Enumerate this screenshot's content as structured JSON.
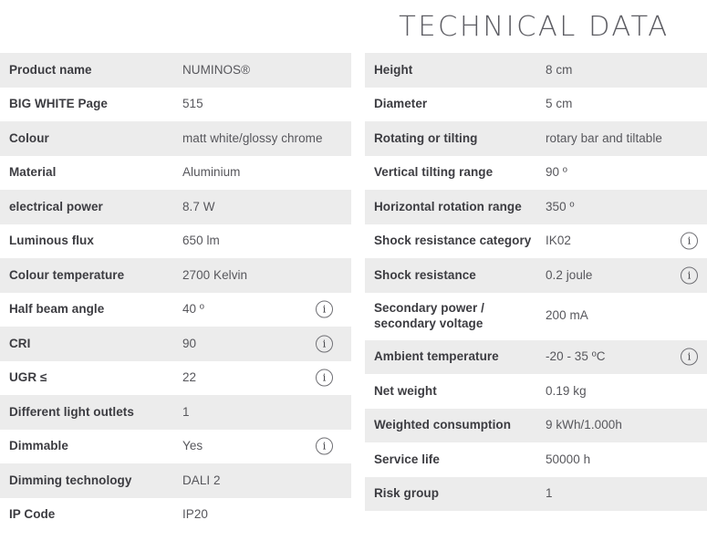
{
  "header": {
    "title": "TECHNICAL DATA"
  },
  "colors": {
    "row_shaded": "#ececec",
    "row_plain": "#ffffff",
    "label_text": "#3c3c41",
    "value_text": "#57575c",
    "title_text": "#5d5d63",
    "icon_border": "#6e6e73"
  },
  "icons": {
    "info": "i"
  },
  "left_column": {
    "rows": [
      {
        "label": "Product name",
        "value": "NUMINOS®",
        "shaded": true,
        "info": false
      },
      {
        "label": "BIG WHITE Page",
        "value": "515",
        "shaded": false,
        "info": false
      },
      {
        "label": "Colour",
        "value": "matt white/glossy chrome",
        "shaded": true,
        "info": false
      },
      {
        "label": "Material",
        "value": "Aluminium",
        "shaded": false,
        "info": false
      },
      {
        "label": "electrical power",
        "value": "8.7 W",
        "shaded": true,
        "info": false
      },
      {
        "label": "Luminous flux",
        "value": "650 lm",
        "shaded": false,
        "info": false
      },
      {
        "label": "Colour temperature",
        "value": "2700 Kelvin",
        "shaded": true,
        "info": false
      },
      {
        "label": "Half beam angle",
        "value": "40 º",
        "shaded": false,
        "info": true
      },
      {
        "label": "CRI",
        "value": "90",
        "shaded": true,
        "info": true
      },
      {
        "label": "UGR ≤",
        "value": "22",
        "shaded": false,
        "info": true
      },
      {
        "label": "Different light outlets",
        "value": "1",
        "shaded": true,
        "info": false
      },
      {
        "label": "Dimmable",
        "value": "Yes",
        "shaded": false,
        "info": true
      },
      {
        "label": "Dimming technology",
        "value": "DALI 2",
        "shaded": true,
        "info": false
      },
      {
        "label": "IP Code",
        "value": "IP20",
        "shaded": false,
        "info": false
      }
    ]
  },
  "right_column": {
    "rows": [
      {
        "label": "Height",
        "value": "8 cm",
        "shaded": true,
        "info": false,
        "tall": false
      },
      {
        "label": "Diameter",
        "value": "5 cm",
        "shaded": false,
        "info": false,
        "tall": false
      },
      {
        "label": "Rotating or tilting",
        "value": "rotary bar and tiltable",
        "shaded": true,
        "info": false,
        "tall": false
      },
      {
        "label": "Vertical tilting range",
        "value": "90 º",
        "shaded": false,
        "info": false,
        "tall": false
      },
      {
        "label": "Horizontal rotation range",
        "value": "350 º",
        "shaded": true,
        "info": false,
        "tall": false
      },
      {
        "label": "Shock resistance category",
        "value": "IK02",
        "shaded": false,
        "info": true,
        "tall": false
      },
      {
        "label": "Shock resistance",
        "value": "0.2 joule",
        "shaded": true,
        "info": true,
        "tall": false
      },
      {
        "label": "Secondary power / secondary voltage",
        "value": "200 mA",
        "shaded": false,
        "info": false,
        "tall": true
      },
      {
        "label": "Ambient temperature",
        "value": "-20 - 35 ºC",
        "shaded": true,
        "info": true,
        "tall": false
      },
      {
        "label": "Net weight",
        "value": "0.19 kg",
        "shaded": false,
        "info": false,
        "tall": false
      },
      {
        "label": "Weighted consumption",
        "value": "9 kWh/1.000h",
        "shaded": true,
        "info": false,
        "tall": false
      },
      {
        "label": "Service life",
        "value": "50000 h",
        "shaded": false,
        "info": false,
        "tall": false
      },
      {
        "label": "Risk group",
        "value": "1",
        "shaded": true,
        "info": false,
        "tall": false
      }
    ]
  }
}
